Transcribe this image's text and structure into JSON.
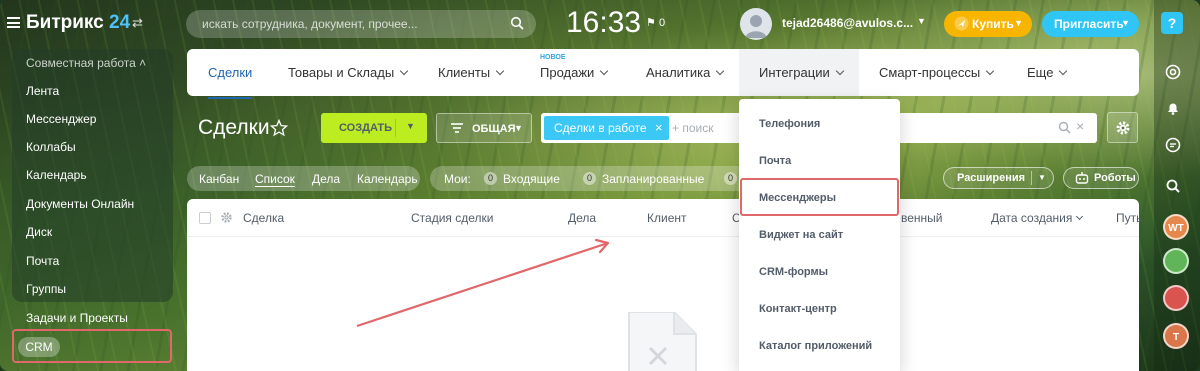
{
  "header": {
    "logo_text": "Битрикс",
    "logo_number": "24",
    "search_placeholder": "искать сотрудника, документ, прочее...",
    "clock": "16:33",
    "flag_count": "0",
    "user_email": "tejad26486@avulos.c...",
    "buy_label": "Купить",
    "invite_label": "Пригласить"
  },
  "sidebar": {
    "group_label": "Совместная работа",
    "items": [
      "Лента",
      "Мессенджер",
      "Коллабы",
      "Календарь",
      "Документы Онлайн",
      "Диск",
      "Почта",
      "Группы"
    ],
    "section_label": "Задачи и Проекты",
    "crm_label": "CRM"
  },
  "nav": {
    "tabs": [
      {
        "label": "Сделки"
      },
      {
        "label": "Товары и Склады"
      },
      {
        "label": "Клиенты"
      },
      {
        "label": "Продажи",
        "badge": "НОВОЕ"
      },
      {
        "label": "Аналитика"
      },
      {
        "label": "Интеграции"
      },
      {
        "label": "Смарт-процессы"
      },
      {
        "label": "Еще"
      }
    ]
  },
  "toolbar": {
    "title": "Сделки",
    "create_label": "СОЗДАТЬ",
    "pipeline_label": "ОБЩАЯ",
    "filter_chip": "Сделки в работе",
    "filter_placeholder": "+ поиск"
  },
  "views": {
    "items": [
      "Канбан",
      "Список",
      "Дела",
      "Календарь"
    ],
    "active": "Список",
    "my_label": "Мои:",
    "counters": [
      {
        "label": "Входящие",
        "count": "0"
      },
      {
        "label": "Запланированные",
        "count": "0"
      },
      {
        "label": "",
        "count": "0"
      }
    ],
    "extensions_label": "Расширения",
    "robots_label": "Роботы"
  },
  "grid": {
    "columns": [
      "Сделка",
      "Стадия сделки",
      "Дела",
      "Клиент",
      "С",
      "венный",
      "Дата создания",
      "Путь"
    ]
  },
  "dropdown": {
    "items": [
      "Телефония",
      "Почта",
      "Мессенджеры",
      "Виджет на сайт",
      "CRM-формы",
      "Контакт-центр",
      "Каталог приложений"
    ],
    "highlighted": "Мессенджеры"
  },
  "rail": {
    "help_label": "?",
    "avatars": [
      {
        "initials": "WT",
        "color": "#e6884b"
      },
      {
        "initials": "",
        "color": "#5fb557"
      },
      {
        "initials": "",
        "color": "#d9534f"
      },
      {
        "initials": "T",
        "color": "#d9764a"
      }
    ]
  },
  "colors": {
    "accent": "#2067b0",
    "create_button": "#bbed21",
    "buy_button": "#f7b500",
    "invite_button": "#2fc6f6",
    "highlight": "#e0676a"
  }
}
